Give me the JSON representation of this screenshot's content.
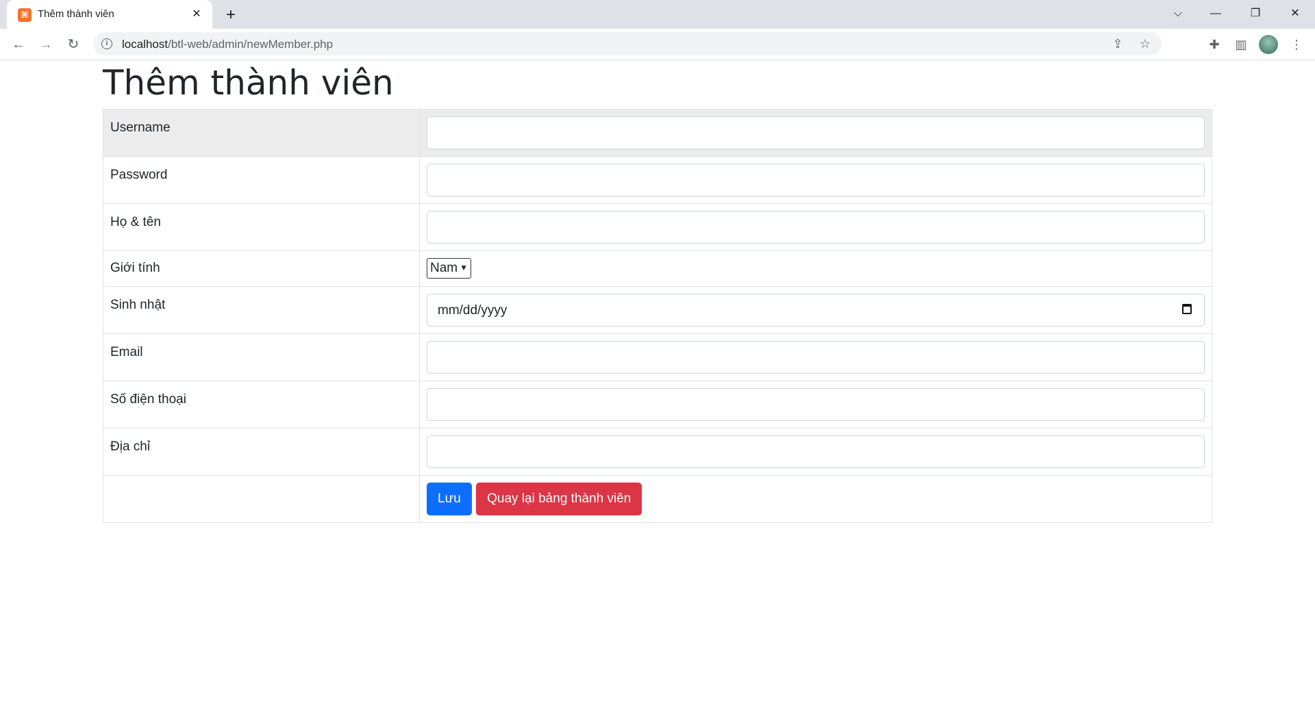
{
  "browser": {
    "tab_title": "Thêm thành viên",
    "url_host": "localhost",
    "url_path": "/btl-web/admin/newMember.php"
  },
  "page": {
    "title": "Thêm thành viên"
  },
  "form": {
    "username_label": "Username",
    "password_label": "Password",
    "fullname_label": "Họ & tên",
    "gender_label": "Giới tính",
    "gender_selected": "Nam",
    "birthday_label": "Sinh nhật",
    "birthday_placeholder": "mm/dd/yyyy",
    "email_label": "Email",
    "phone_label": "Số điện thoại",
    "address_label": "Địa chỉ",
    "save_label": "Lưu",
    "back_label": "Quay lại bảng thành viên"
  },
  "colors": {
    "primary": "#0d6efd",
    "danger": "#dc3545",
    "row_highlight": "#ececec"
  }
}
